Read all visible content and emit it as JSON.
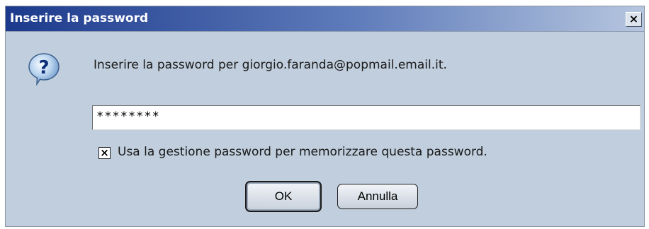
{
  "window": {
    "title": "Inserire la password",
    "close_label": "×"
  },
  "prompt": {
    "text": "Inserire la password per giorgio.faranda@popmail.email.it.",
    "icon": "question-icon"
  },
  "password_field": {
    "value": "********"
  },
  "remember": {
    "checked": true,
    "mark": "×",
    "label": "Usa la gestione password per memorizzare questa password."
  },
  "buttons": {
    "ok_label": "OK",
    "cancel_label": "Annulla"
  }
}
